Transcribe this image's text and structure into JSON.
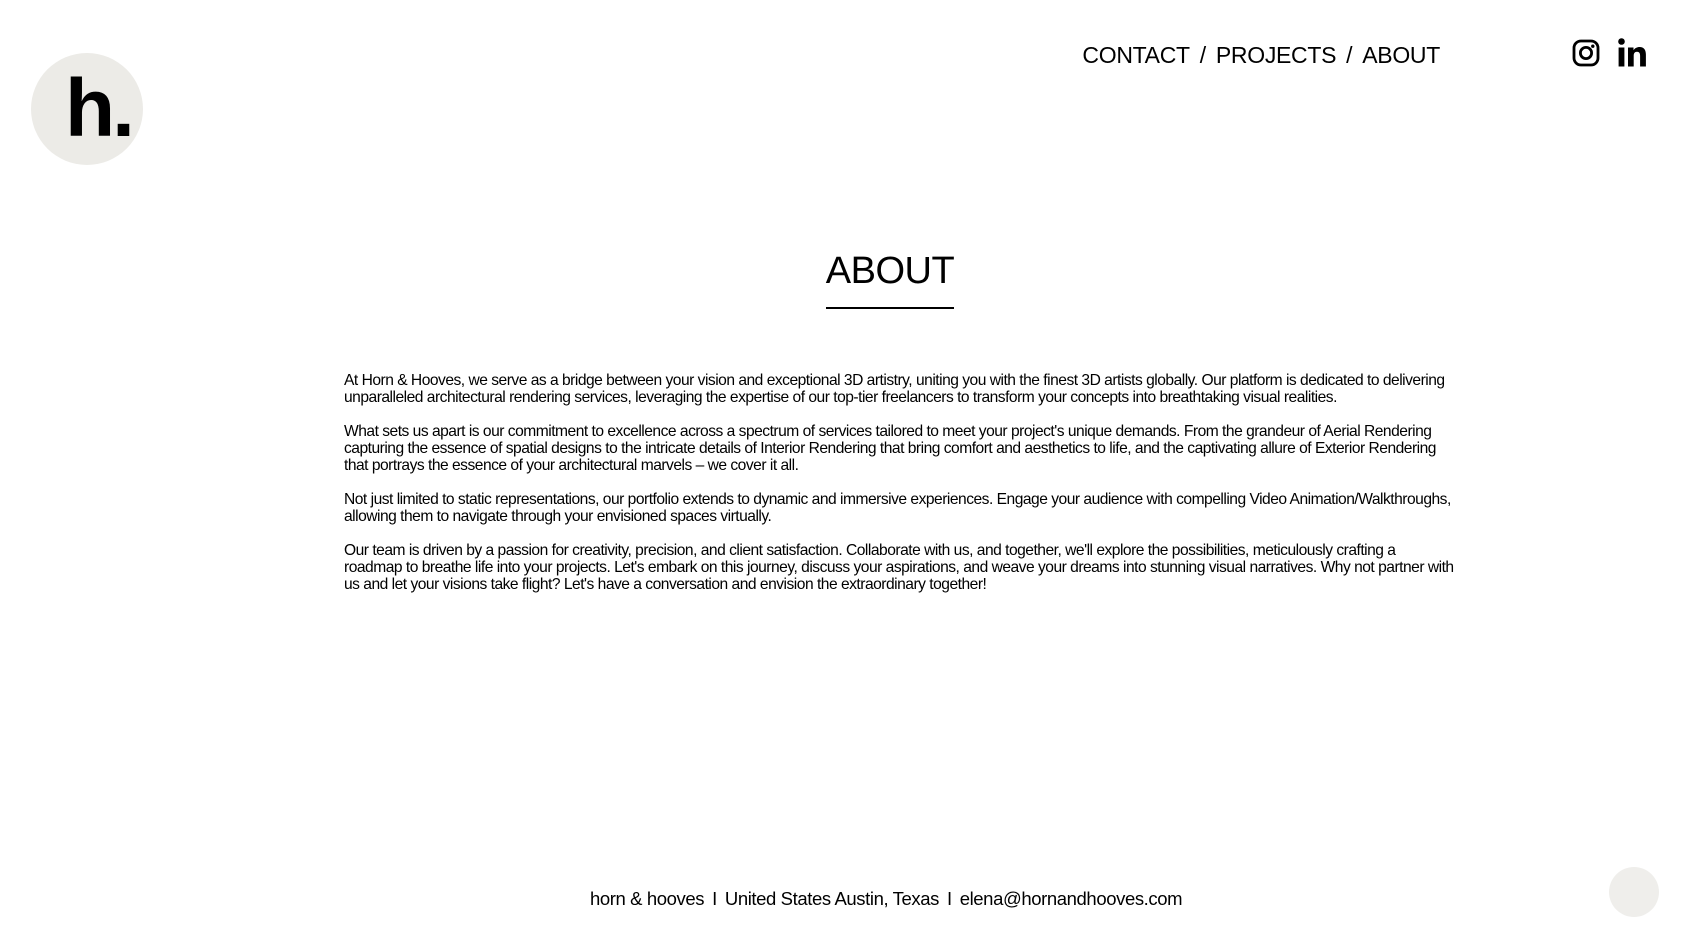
{
  "header": {
    "logo_text": "h.",
    "nav": [
      {
        "label": "CONTACT"
      },
      {
        "label": "PROJECTS"
      },
      {
        "label": "ABOUT"
      }
    ],
    "nav_separator": "/",
    "social": [
      {
        "icon": "instagram-icon"
      },
      {
        "icon": "linkedin-icon"
      }
    ]
  },
  "main": {
    "title": "ABOUT",
    "paragraphs": [
      "At Horn & Hooves, we serve as a bridge between your vision and exceptional 3D artistry, uniting you with the finest 3D artists globally. Our platform is dedicated to delivering unparalleled architectural rendering services, leveraging the expertise of our top-tier freelancers to transform your concepts into breathtaking visual realities.",
      "What sets us apart is our commitment to excellence across a spectrum of services tailored to meet your project's unique demands. From the grandeur of Aerial Rendering capturing the essence of spatial designs to the intricate details of Interior Rendering that bring comfort and aesthetics to life, and the captivating allure of Exterior Rendering that portrays the essence of your architectural marvels – we cover it all.",
      "Not just limited to static representations, our portfolio extends to dynamic and immersive experiences. Engage your audience with compelling Video Animation/Walkthroughs, allowing them to navigate through your envisioned spaces virtually.",
      "Our team is driven by a passion for creativity, precision, and client satisfaction. Collaborate with us, and together, we'll explore the possibilities, meticulously crafting a roadmap to breathe life into your projects. Let's embark on this journey, discuss your aspirations, and weave your dreams into stunning visual narratives. Why not partner with us and let your visions take flight? Let's have a conversation and envision the extraordinary together!"
    ]
  },
  "footer": {
    "brand": "horn & hooves",
    "location": "United States Austin, Texas",
    "email": "elena@hornandhooves.com",
    "separator": "I"
  },
  "colors": {
    "logo_circle": "#ecebe7",
    "text": "#000000",
    "background": "#ffffff"
  }
}
